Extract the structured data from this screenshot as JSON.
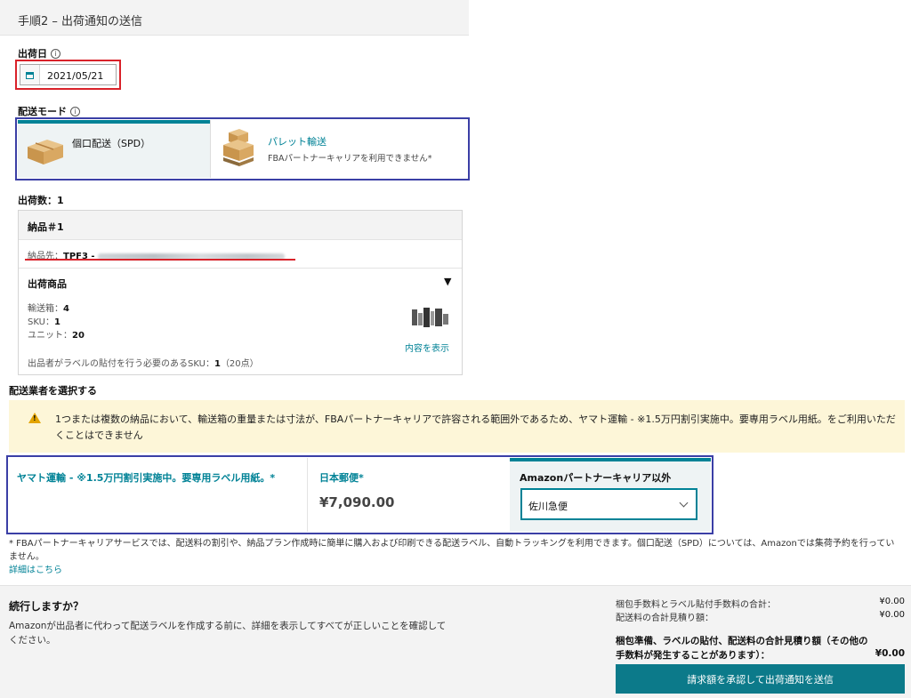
{
  "header": {
    "title": "手順2 – 出荷通知の送信"
  },
  "ship_date": {
    "label": "出荷日",
    "info": "i",
    "value": "2021/05/21"
  },
  "shipping_mode": {
    "label": "配送モード",
    "info": "i",
    "spd": {
      "title": "個口配送（SPD）",
      "selected": true
    },
    "pallet": {
      "title": "パレット輸送",
      "subtitle": "FBAパートナーキャリアを利用できません*"
    }
  },
  "shipments": {
    "count_label": "出荷数：1",
    "item": {
      "title": "納品＃1",
      "dest_label": "納品先：",
      "dest_code": "TPF3 -",
      "products_label": "出荷商品",
      "toggle": "▼",
      "boxes_label": "輸送箱：",
      "boxes_value": "4",
      "sku_label": "SKU：",
      "sku_value": "1",
      "units_label": "ユニット：",
      "units_value": "20",
      "view_contents": "内容を表示",
      "label_sku_text": "出品者がラベルの貼付を行う必要のあるSKU：",
      "label_sku_value": "1",
      "label_sku_units": "（20点）"
    }
  },
  "carrier": {
    "section_label": "配送業者を選択する",
    "warning": "1つまたは複数の納品において、輸送箱の重量または寸法が、FBAパートナーキャリアで許容される範囲外であるため、ヤマト運輸 - ※1.5万円割引実施中。要専用ラベル用紙。をご利用いただくことはできません",
    "yamato": {
      "label": "ヤマト運輸 - ※1.5万円割引実施中。要専用ラベル用紙。*"
    },
    "japan_post": {
      "label": "日本郵便*",
      "price": "¥7,090.00"
    },
    "other": {
      "label": "Amazonパートナーキャリア以外",
      "selected_value": "佐川急便"
    }
  },
  "footnote": {
    "text": "* FBAパートナーキャリアサービスでは、配送料の割引や、納品プラン作成時に簡単に購入および印刷できる配送ラベル、自動トラッキングを利用できます。個口配送（SPD）については、Amazonでは集荷予約を行っていません。",
    "link": "詳細はこちら"
  },
  "footer": {
    "title": "続行しますか？",
    "description": "Amazonが出品者に代わって配送ラベルを作成する前に、詳細を表示してすべてが正しいことを確認してください。",
    "fee1_label": "梱包手数料とラベル貼付手数料の合計：",
    "fee1_value": "¥0.00",
    "fee2_label": "配送料の合計見積り額：",
    "fee2_value": "¥0.00",
    "total_label": "梱包準備、ラベルの貼付、配送料の合計見積り額（その他の手数料が発生することがあります）：",
    "total_value": "¥0.00",
    "submit_label": "請求額を承認して出荷通知を送信"
  },
  "colors": {
    "accent": "#008296",
    "highlight_red": "#d9222a",
    "highlight_blue": "#3b3fa6",
    "warning_bg": "#fdf6d8",
    "button": "#0c7a8a"
  }
}
